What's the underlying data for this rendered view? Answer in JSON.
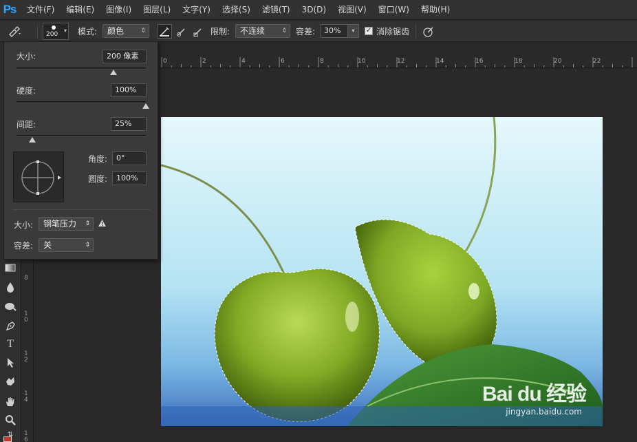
{
  "app": {
    "logo": "Ps"
  },
  "menu": [
    "文件(F)",
    "编辑(E)",
    "图像(I)",
    "图层(L)",
    "文字(Y)",
    "选择(S)",
    "滤镜(T)",
    "3D(D)",
    "视图(V)",
    "窗口(W)",
    "帮助(H)"
  ],
  "options": {
    "brush_size_preview": "200",
    "mode_label": "模式:",
    "mode_value": "颜色",
    "limit_label": "限制:",
    "limit_value": "不连续",
    "tolerance_label": "容差:",
    "tolerance_value": "30%",
    "antialias_label": "消除锯齿",
    "antialias_checked": true
  },
  "brush_panel": {
    "size_label": "大小:",
    "size_value": "200 像素",
    "size_fraction": 0.75,
    "hardness_label": "硬度:",
    "hardness_value": "100%",
    "hardness_fraction": 1.0,
    "spacing_label": "间距:",
    "spacing_value": "25%",
    "spacing_fraction": 0.12,
    "angle_label": "角度:",
    "angle_value": "0°",
    "roundness_label": "圆度:",
    "roundness_value": "100%",
    "pen_size_label": "大小:",
    "pen_size_value": "钢笔压力",
    "pen_tolerance_label": "容差:",
    "pen_tolerance_value": "关"
  },
  "rulers": {
    "horizontal": [
      "0",
      "2",
      "4",
      "6",
      "8",
      "10",
      "12",
      "14",
      "16",
      "18",
      "20",
      "22"
    ],
    "vertical": [
      "8",
      "1\n0",
      "1\n2",
      "1\n4",
      "1\n6"
    ]
  },
  "watermark": {
    "brand": "Bai du 经验",
    "url": "jingyan.baidu.com"
  },
  "colors": {
    "accent": "#31a8ff",
    "panel": "#3a3a3a",
    "background": "#282828"
  }
}
